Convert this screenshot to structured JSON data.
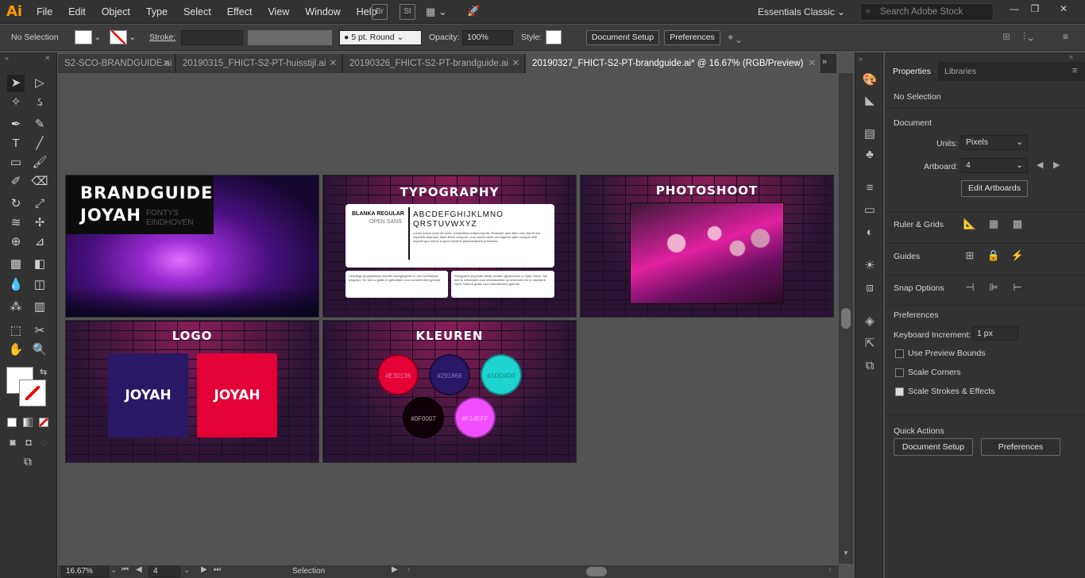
{
  "app": {
    "logo": "Ai",
    "menu": [
      "File",
      "Edit",
      "Object",
      "Type",
      "Select",
      "Effect",
      "View",
      "Window",
      "Help"
    ],
    "bridge": "Br",
    "stock": "St",
    "workspace": "Essentials Classic",
    "search_placeholder": "Search Adobe Stock"
  },
  "control": {
    "selection": "No Selection",
    "stroke_label": "Stroke:",
    "brush": "5 pt. Round",
    "opacity_label": "Opacity:",
    "opacity": "100%",
    "style_label": "Style:",
    "doc_setup": "Document Setup",
    "prefs": "Preferences"
  },
  "tabs": [
    "S2-SCO-BRANDGUIDE.ai",
    "20190315_FHICT-S2-PT-huisstijl.ai",
    "20190326_FHICT-S2-PT-brandguide.ai",
    "20190327_FHICT-S2-PT-brandguide.ai* @ 16.67% (RGB/Preview)"
  ],
  "artboards": {
    "cover": {
      "title1": "BRANDGUIDE",
      "title2": "JOYAH",
      "sub1": "FONTYS",
      "sub2": "EINDHOVEN"
    },
    "typography": {
      "title": "TYPOGRAPHY",
      "font1": "BLANKA REGULAR",
      "font2": "OPEN SANS",
      "alpha1": "ABCDEFGHIJKLMNO",
      "alpha2": "QRSTUVWXYZ",
      "body": "Lorem ipsum dolor sit amet, consectetur adipiscing elit. Praesent quis libero nec faci et est expedita distinctio. Nam libero tempore, cum soluta nobis est eligendi optio cumque nihil impedit quo minus id quod maxime placeat facere possimus.",
      "box1": "Headings (koppeltekst) worden weergegeven in het font Blanka (regular). De font is gratis te gebruiken voor commercieel gebruik.",
      "box2": "Paragrafen (lopende tekst) worden geschreven in Open Sans. Het font is ontworpen voor leesbaarheid op schermen en in drukwerk. Open Sans is gratis voor commercieel gebruik."
    },
    "photoshoot": {
      "title": "PHOTOSHOOT"
    },
    "logo": {
      "title": "LOGO",
      "mark1": "JOYAH",
      "mark2": "JOYAH"
    },
    "kleuren": {
      "title": "KLEUREN",
      "swatches": [
        {
          "hex": "#E30136",
          "label": "#E30136"
        },
        {
          "hex": "#291866",
          "label": "#291866"
        },
        {
          "hex": "#1DD4D0",
          "label": "#1DD4D0"
        },
        {
          "hex": "#0F0007",
          "label": "#0F0007"
        },
        {
          "hex": "#F14EFF",
          "label": "#F14EFF"
        }
      ]
    }
  },
  "properties": {
    "tabs": [
      "Properties",
      "Libraries"
    ],
    "no_selection": "No Selection",
    "document": "Document",
    "units_label": "Units:",
    "units": "Pixels",
    "artboard_label": "Artboard:",
    "artboard": "4",
    "edit_artboards": "Edit Artboards",
    "ruler": "Ruler & Grids",
    "guides": "Guides",
    "snap": "Snap Options",
    "preferences": "Preferences",
    "kbd_label": "Keyboard Increment:",
    "kbd": "1 px",
    "cb1": "Use Preview Bounds",
    "cb2": "Scale Corners",
    "cb3": "Scale Strokes & Effects",
    "quick": "Quick Actions",
    "qa1": "Document Setup",
    "qa2": "Preferences"
  },
  "status": {
    "zoom": "16.67%",
    "page": "4",
    "tool": "Selection"
  }
}
